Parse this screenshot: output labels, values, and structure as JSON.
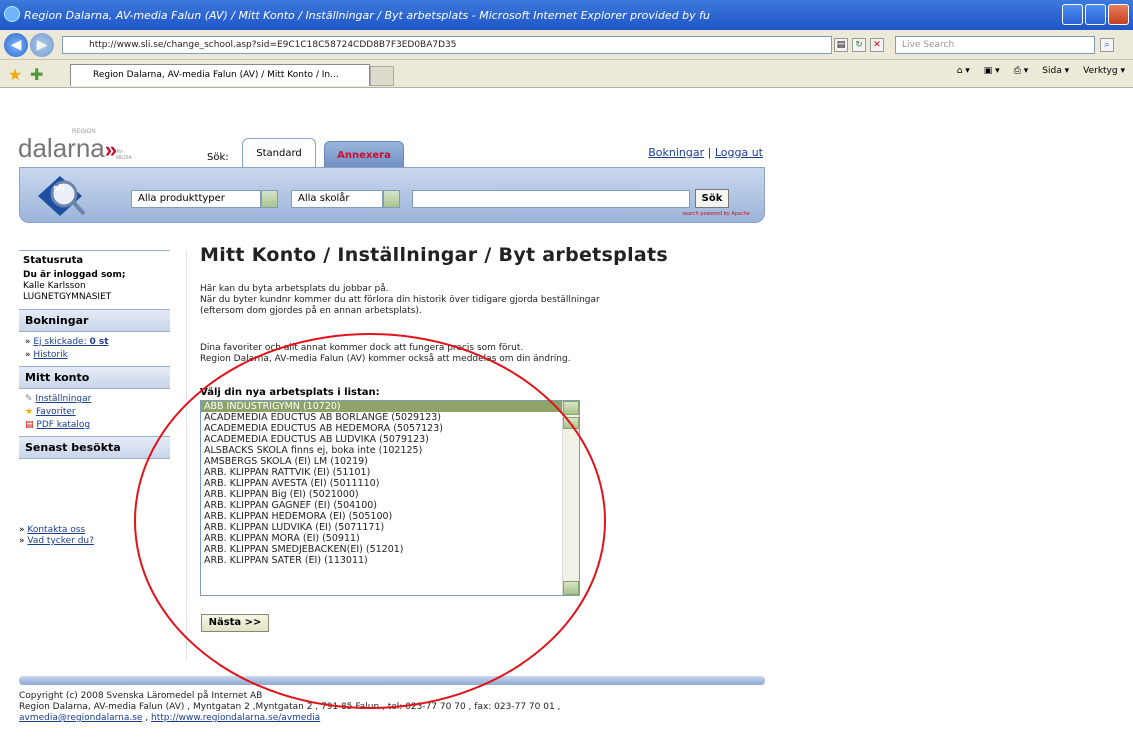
{
  "browser": {
    "title": "Region Dalarna, AV-media Falun (AV) / Mitt Konto / Inställningar / Byt arbetsplats - Microsoft Internet Explorer provided by fu",
    "address": "http://www.sli.se/change_school.asp?sid=E9C1C18C58724CDD8B7F3ED0BA7D35",
    "search_placeholder": "Live Search",
    "tab_label": "Region Dalarna, AV-media Falun (AV) / Mitt Konto / In...",
    "cmd_sida": "Sida",
    "cmd_verktyg": "Verktyg"
  },
  "header": {
    "logo_text": "dalarna",
    "logo_region": "REGION",
    "logo_sub": "AV-MEDIA",
    "sok_label": "Sök:",
    "tab_standard": "Standard",
    "tab_annexera": "Annexera",
    "link_bokningar": "Bokningar",
    "link_separator": "|",
    "link_logga_ut": "Logga ut",
    "select_products": "Alla produkttyper",
    "select_grades": "Alla skolår",
    "search_button": "Sök",
    "powered": "search powered by Apache"
  },
  "sidebar": {
    "status_head": "Statusruta",
    "logged_in_label": "Du är inloggad som;",
    "user_name": "Kalle Karlsson",
    "school": "LUGNETGYMNASIET",
    "bokningar_head": "Bokningar",
    "ej_skickade_label": "Ej skickade:",
    "ej_skickade_value": "0 st",
    "historik": "Historik",
    "mitt_konto_head": "Mitt konto",
    "installningar": "Inställningar",
    "favoriter": "Favoriter",
    "pdf_katalog": "PDF katalog",
    "senast_head": "Senast besökta",
    "kontakta": "Kontakta oss",
    "vad_tycker": "Vad tycker du?"
  },
  "main": {
    "title": "Mitt Konto / Inställningar / Byt arbetsplats",
    "p1_l1": "Här kan du byta arbetsplats du jobbar på.",
    "p1_l2": "När du byter kundnr kommer du att förlora din historik över tidigare gjorda beställningar",
    "p1_l3": "(eftersom dom gjordes på en annan arbetsplats).",
    "p2_l1": "Dina favoriter och allt annat kommer dock att fungera precis som förut.",
    "p2_l2": "Region Dalarna, AV-media Falun (AV) kommer också att meddelas om din ändring.",
    "list_label": "Välj din nya arbetsplats i listan:",
    "workplaces": [
      "ABB INDUSTRIGYMN (10720)",
      "ACADEMEDIA EDUCTUS AB BORLÄNGE (5029123)",
      "ACADEMEDIA EDUCTUS AB HEDEMORA (5057123)",
      "ACADEMEDIA EDUCTUS AB LUDVIKA (5079123)",
      "ALSBÄCKS SKOLA finns ej, boka inte (102125)",
      "AMSBERGS SKOLA (EI) LM (10219)",
      "ARB. KLIPPAN RÄTTVIK (EI) (51101)",
      "ARB. KLIPPAN AVESTA (EI) (5011110)",
      "ARB. KLIPPAN Big (EI) (5021000)",
      "ARB. KLIPPAN GAGNEF (EI) (504100)",
      "ARB. KLIPPAN HEDEMORA (EI) (505100)",
      "ARB. KLIPPAN LUDVIKA (EI) (5071171)",
      "ARB. KLIPPAN MORA (EI) (50911)",
      "ARB. KLIPPAN SMEDJEBACKEN(EI) (51201)",
      "ARB. KLIPPAN SÄTER (EI) (113011)"
    ],
    "next_button": "Nästa >>"
  },
  "footer": {
    "line1": "Copyright (c) 2008 Svenska Läromedel på Internet AB",
    "line2": "Region Dalarna, AV-media Falun (AV) , Myntgatan 2 ,Myntgatan 2 , 791 85  Falun , tel: 023-77 70 70 , fax: 023-77 70 01 ,",
    "email": "avmedia@regiondalarna.se",
    "sep": " , ",
    "url": "http://www.regiondalarna.se/avmedia"
  },
  "colors": {
    "annotation_circle": "#e0141b",
    "selected_option": "#8da368",
    "link": "#1a3e94"
  }
}
